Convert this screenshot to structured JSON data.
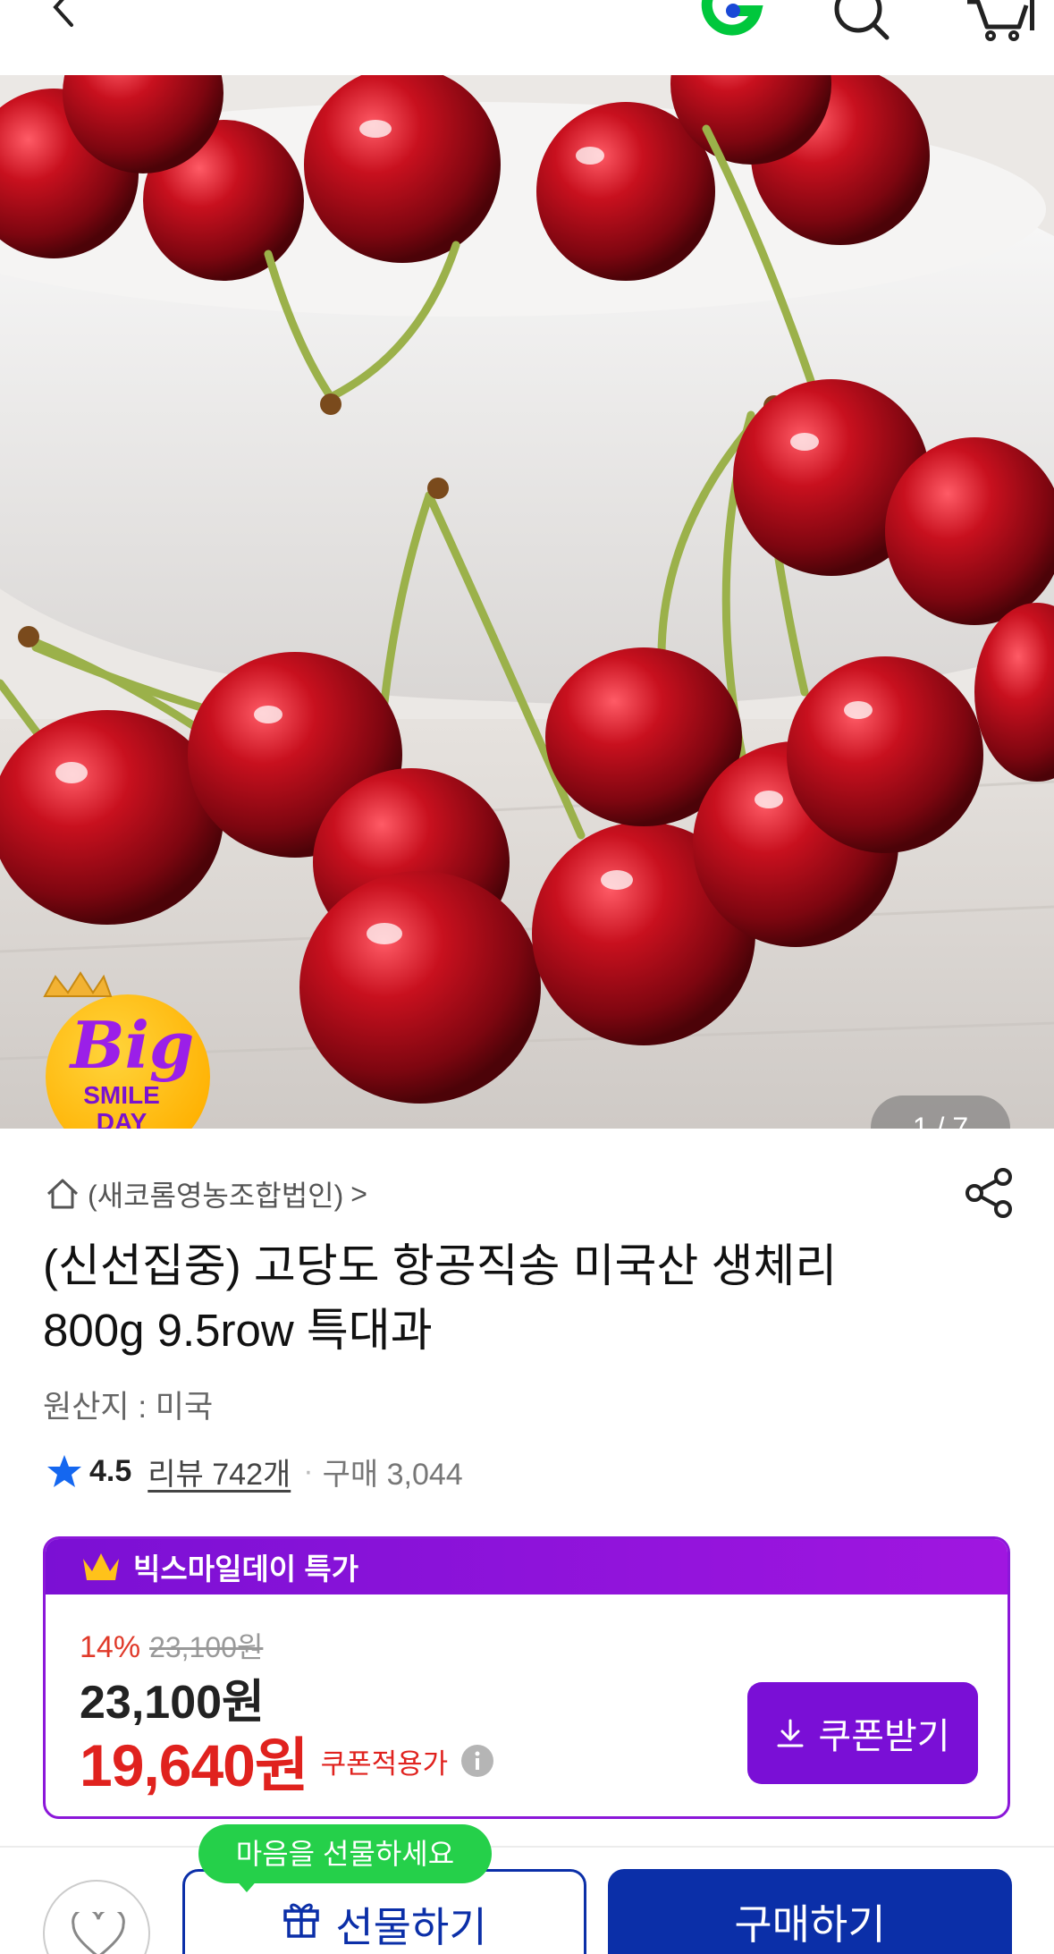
{
  "header": {
    "back_icon": "chevron-left-icon",
    "logo_icon": "g-logo-icon",
    "search_icon": "search-icon",
    "cart_icon": "cart-icon",
    "logo_colors": [
      "#00c73c",
      "#1a48d6"
    ]
  },
  "gallery": {
    "badge": {
      "line1": "Big",
      "line2": "SMILE",
      "line3": "DAY"
    },
    "pager": "1 / 7"
  },
  "product": {
    "seller": "(새코롬영농조합법인)",
    "seller_chevron": ">",
    "title_line1": "(신선집중) 고당도 항공직송 미국산 생체리",
    "title_line2": "800g 9.5row 특대과",
    "origin": "원산지 : 미국",
    "rating": "4.5",
    "reviews": "리뷰 742개",
    "separator": "·",
    "purchases": "구매 3,044"
  },
  "deal": {
    "header_title": "빅스마일데이 특가",
    "discount_percent": "14%",
    "original_price": "23,100원",
    "price": "23,100원",
    "coupon_price": "19,640원",
    "coupon_label": "쿠폰적용가",
    "coupon_button": "쿠폰받기",
    "accent_color": "#7a0fd6",
    "sale_color": "#e0221e"
  },
  "bottom_bar": {
    "tooltip": "마음을 선물하세요",
    "gift_label": "선물하기",
    "buy_label": "구매하기",
    "primary_color": "#0b2fa8",
    "tooltip_color": "#25d04a"
  }
}
